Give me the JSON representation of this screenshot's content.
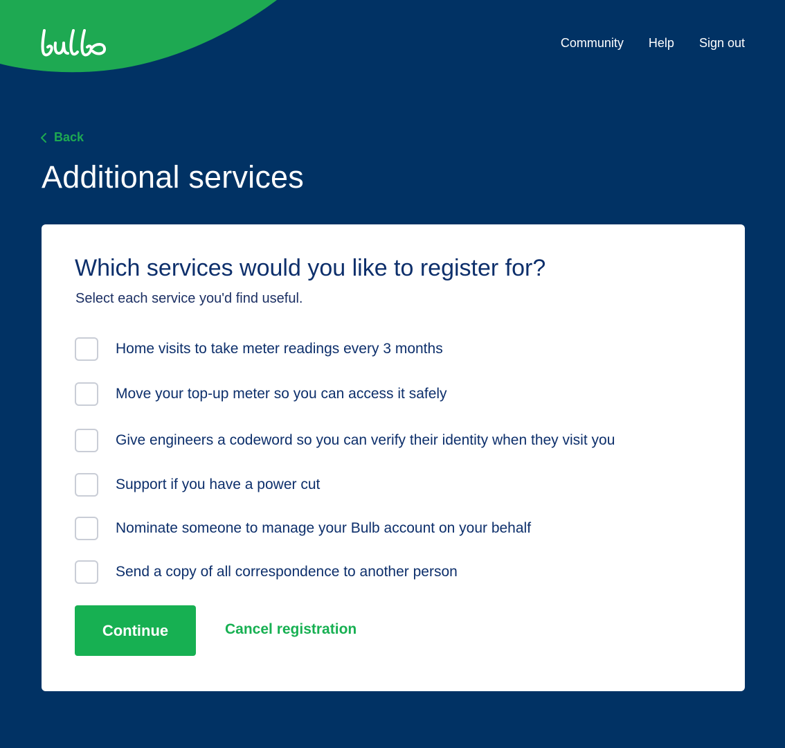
{
  "brand": {
    "logo_text": "bulb"
  },
  "nav": {
    "community": "Community",
    "help": "Help",
    "sign_out": "Sign out"
  },
  "back": {
    "label": "Back"
  },
  "page": {
    "title": "Additional services"
  },
  "form": {
    "heading": "Which services would you like to register for?",
    "subheading": "Select each service you'd find useful.",
    "options": [
      {
        "label": "Home visits to take meter readings every 3 months",
        "checked": false
      },
      {
        "label": "Move your top-up meter so you can access it safely",
        "checked": false
      },
      {
        "label": "Give engineers a codeword so you can verify their identity when they visit you",
        "checked": false
      },
      {
        "label": "Support if you have a power cut",
        "checked": false
      },
      {
        "label": "Nominate someone to manage your Bulb account on your behalf",
        "checked": false
      },
      {
        "label": "Send a copy of all correspondence to another person",
        "checked": false
      }
    ],
    "continue_label": "Continue",
    "cancel_label": "Cancel registration"
  },
  "colors": {
    "background": "#013264",
    "brand_green": "#17b052",
    "text_navy": "#0d2f6b",
    "card": "#ffffff"
  }
}
